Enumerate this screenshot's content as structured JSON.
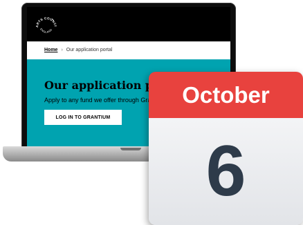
{
  "logo": {
    "text_top": "ARTS COUNCIL",
    "text_bottom": "ENGLAND"
  },
  "breadcrumb": {
    "home": "Home",
    "separator": "›",
    "current": "Our application portal"
  },
  "hero": {
    "title": "Our application portal",
    "text": "Apply to any fund we offer through Grantium",
    "button_label": "LOG IN TO GRANTIUM"
  },
  "calendar": {
    "month": "October",
    "day": "6"
  },
  "colors": {
    "hero_teal": "#00a3b0",
    "calendar_red": "#e8423e",
    "calendar_number": "#2e3b4a"
  }
}
